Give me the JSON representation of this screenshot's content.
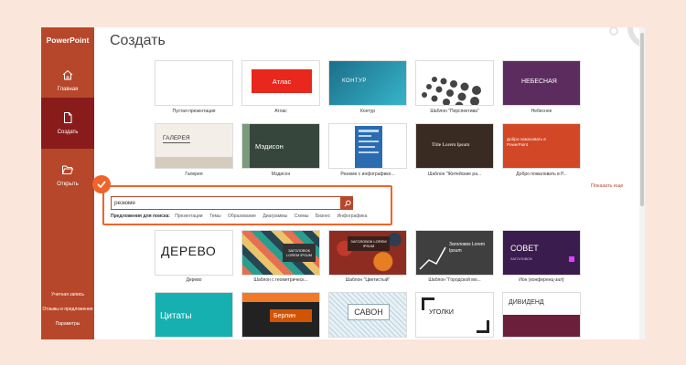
{
  "app": {
    "name": "PowerPoint"
  },
  "nav": {
    "home": "Главная",
    "create": "Создать",
    "open": "Открыть"
  },
  "bottom_links": [
    "Учетная запись",
    "Отзывы и предложения",
    "Параметры"
  ],
  "page_title": "Создать",
  "show_more": "Показать еще",
  "templates": [
    {
      "label": "Пустая презентация"
    },
    {
      "label": "Атлас",
      "title": "Атлас"
    },
    {
      "label": "Контур",
      "title": "КОНТУР"
    },
    {
      "label": "Шаблон \"Перспектива\""
    },
    {
      "label": "Небесное",
      "title": "НЕБЕСНАЯ"
    },
    {
      "label": "Галерея",
      "title": "ГАЛЕРЕЯ"
    },
    {
      "label": "Мэдисон",
      "title": "Мэдисон"
    },
    {
      "label": "Резюме с инфографико..."
    },
    {
      "label": "Шаблон \"Житейские ра...",
      "title": "Title Lorem Ipsum"
    },
    {
      "label": "Добро пожаловать в Р...",
      "title": "Добро пожаловать в PowerPoint"
    },
    {
      "label": "Дерево",
      "title": "ДЕРЕВО"
    },
    {
      "label": "Шаблон с геометрическ...",
      "title": "ЗАГОЛОВОК LOREM IPSUM"
    },
    {
      "label": "Шаблон \"Цветистый\"",
      "title": "ЗАГОЛОВОК LOREM IPSUM"
    },
    {
      "label": "Шаблон \"Городской мо...",
      "title": "Заголовок Lorem Ipsum"
    },
    {
      "label": "Ион (конференц-зал)",
      "title": "СОВЕТ",
      "subtitle": "ЗАГОЛОВОК"
    },
    {
      "title": "Цитаты"
    },
    {
      "title": "Берлин"
    },
    {
      "title": "САВОН"
    },
    {
      "title": "УГОЛКИ"
    },
    {
      "title": "ДИВИДЕНД"
    }
  ],
  "search": {
    "value": "резюме",
    "suggest_label": "Предложения для поиска:",
    "suggestions": [
      "Презентации",
      "Темы",
      "Образование",
      "Диаграммы",
      "Схемы",
      "Бизнес",
      "Инфографика"
    ]
  },
  "colors": {
    "brand": "#b7472a",
    "sidebar_active": "#8a1b1b",
    "highlight": "#f0632a"
  },
  "icons": {
    "home": "home-icon",
    "create": "new-file-icon",
    "open": "folder-open-icon",
    "search": "search-icon",
    "badge": "check-icon"
  }
}
